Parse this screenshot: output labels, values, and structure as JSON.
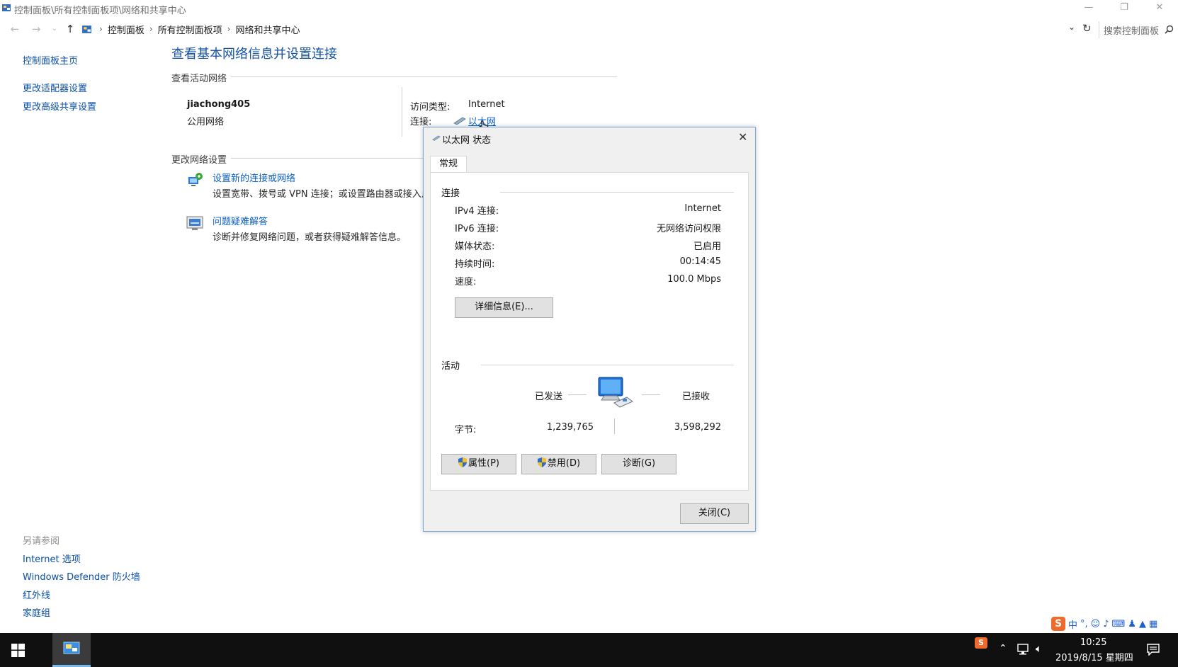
{
  "window": {
    "title": "控制面板\\所有控制面板项\\网络和共享中心",
    "controls": {
      "minimize": "—",
      "restore": "❐",
      "close": "✕"
    }
  },
  "address_bar": {
    "crumbs": [
      "控制面板",
      "所有控制面板项",
      "网络和共享中心"
    ],
    "search_placeholder": "搜索控制面板"
  },
  "sidebar": {
    "links": [
      "控制面板主页",
      "更改适配器设置",
      "更改高级共享设置"
    ],
    "see_also_title": "另请参阅",
    "see_also": [
      "Internet 选项",
      "Windows Defender 防火墙",
      "红外线",
      "家庭组"
    ]
  },
  "main": {
    "heading": "查看基本网络信息并设置连接",
    "active_networks_label": "查看活动网络",
    "network_name": "jiachong405",
    "network_type": "公用网络",
    "access_type_label": "访问类型:",
    "access_type_value": "Internet",
    "connection_label": "连接:",
    "connection_value": "以太网",
    "change_settings_label": "更改网络设置",
    "tasks": [
      {
        "title": "设置新的连接或网络",
        "desc": "设置宽带、拨号或 VPN 连接；或设置路由器或接入点"
      },
      {
        "title": "问题疑难解答",
        "desc": "诊断并修复网络问题，或者获得疑难解答信息。"
      }
    ]
  },
  "dialog": {
    "title": "以太网 状态",
    "tab": "常规",
    "connection_group": "连接",
    "rows": [
      {
        "label": "IPv4 连接:",
        "value": "Internet"
      },
      {
        "label": "IPv6 连接:",
        "value": "无网络访问权限"
      },
      {
        "label": "媒体状态:",
        "value": "已启用"
      },
      {
        "label": "持续时间:",
        "value": "00:14:45"
      },
      {
        "label": "速度:",
        "value": "100.0 Mbps"
      }
    ],
    "details_button": "详细信息(E)...",
    "activity_group": "活动",
    "sent_label": "已发送",
    "received_label": "已接收",
    "bytes_label": "字节:",
    "bytes_sent": "1,239,765",
    "bytes_received": "3,598,292",
    "properties_button": "属性(P)",
    "disable_button": "禁用(D)",
    "diagnose_button": "诊断(G)",
    "close_button": "关闭(C)"
  },
  "taskbar": {
    "time": "10:25",
    "date": "2019/8/15 星期四",
    "ime_lang": "中"
  },
  "colors": {
    "link": "#0a5fc8",
    "heading": "#1552a4",
    "taskbar": "#101010",
    "dialog_border": "#7aa7d9"
  }
}
